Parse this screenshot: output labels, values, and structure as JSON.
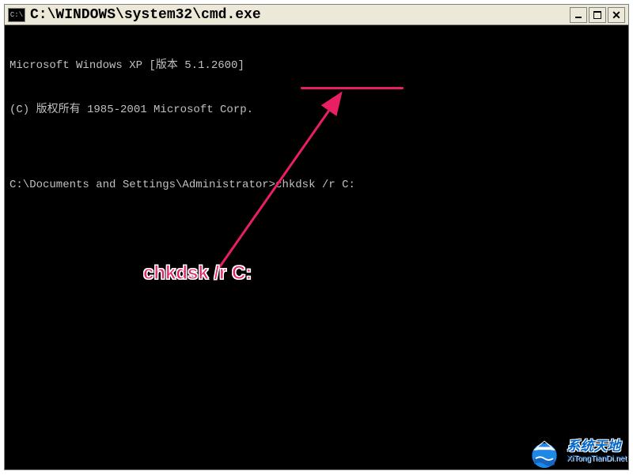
{
  "titlebar": {
    "icon_label": "C:\\",
    "title": "C:\\WINDOWS\\system32\\cmd.exe"
  },
  "terminal": {
    "line1": "Microsoft Windows XP [版本 5.1.2600]",
    "line2": "(C) 版权所有 1985-2001 Microsoft Corp.",
    "blank": "",
    "prompt": "C:\\Documents and Settings\\Administrator>",
    "command": "chkdsk /r C:"
  },
  "annotation": {
    "label": "chkdsk /r C:",
    "color": "#e91e63"
  },
  "watermark": {
    "main": "系统天地",
    "sub": "XiTongTianDi.net"
  }
}
